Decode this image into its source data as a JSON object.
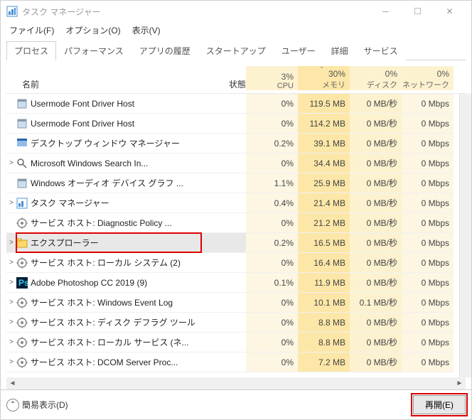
{
  "window": {
    "title": "タスク マネージャー"
  },
  "menus": [
    "ファイル(F)",
    "オプション(O)",
    "表示(V)"
  ],
  "tabs": [
    "プロセス",
    "パフォーマンス",
    "アプリの履歴",
    "スタートアップ",
    "ユーザー",
    "詳細",
    "サービス"
  ],
  "headers": {
    "name": "名前",
    "status": "状態",
    "cols": [
      {
        "pct": "3%",
        "lbl": "CPU",
        "sort": false
      },
      {
        "pct": "30%",
        "lbl": "メモリ",
        "sort": true
      },
      {
        "pct": "0%",
        "lbl": "ディスク",
        "sort": false
      },
      {
        "pct": "0%",
        "lbl": "ネットワーク",
        "sort": false
      }
    ]
  },
  "rows": [
    {
      "exp": "",
      "icon": "app",
      "name": "Usermode Font Driver Host",
      "cpu": "0%",
      "mem": "119.5 MB",
      "disk": "0 MB/秒",
      "net": "0 Mbps"
    },
    {
      "exp": "",
      "icon": "app",
      "name": "Usermode Font Driver Host",
      "cpu": "0%",
      "mem": "114.2 MB",
      "disk": "0 MB/秒",
      "net": "0 Mbps"
    },
    {
      "exp": "",
      "icon": "dwm",
      "name": "デスクトップ ウィンドウ マネージャー",
      "cpu": "0.2%",
      "mem": "39.1 MB",
      "disk": "0 MB/秒",
      "net": "0 Mbps"
    },
    {
      "exp": ">",
      "icon": "search",
      "name": "Microsoft Windows Search In...",
      "cpu": "0%",
      "mem": "34.4 MB",
      "disk": "0 MB/秒",
      "net": "0 Mbps"
    },
    {
      "exp": "",
      "icon": "app",
      "name": "Windows オーディオ デバイス グラフ ...",
      "cpu": "1.1%",
      "mem": "25.9 MB",
      "disk": "0 MB/秒",
      "net": "0 Mbps"
    },
    {
      "exp": ">",
      "icon": "tm",
      "name": "タスク マネージャー",
      "cpu": "0.4%",
      "mem": "21.4 MB",
      "disk": "0 MB/秒",
      "net": "0 Mbps"
    },
    {
      "exp": "",
      "icon": "svc",
      "name": "サービス ホスト: Diagnostic Policy ...",
      "cpu": "0%",
      "mem": "21.2 MB",
      "disk": "0 MB/秒",
      "net": "0 Mbps"
    },
    {
      "exp": ">",
      "icon": "exp",
      "name": "エクスプローラー",
      "cpu": "0.2%",
      "mem": "16.5 MB",
      "disk": "0 MB/秒",
      "net": "0 Mbps",
      "sel": true,
      "hl": true
    },
    {
      "exp": ">",
      "icon": "svc",
      "name": "サービス ホスト: ローカル システム (2)",
      "cpu": "0%",
      "mem": "16.4 MB",
      "disk": "0 MB/秒",
      "net": "0 Mbps"
    },
    {
      "exp": ">",
      "icon": "ps",
      "name": "Adobe Photoshop CC 2019 (9)",
      "cpu": "0.1%",
      "mem": "11.9 MB",
      "disk": "0 MB/秒",
      "net": "0 Mbps"
    },
    {
      "exp": ">",
      "icon": "svc",
      "name": "サービス ホスト: Windows Event Log",
      "cpu": "0%",
      "mem": "10.1 MB",
      "disk": "0.1 MB/秒",
      "net": "0 Mbps"
    },
    {
      "exp": ">",
      "icon": "svc",
      "name": "サービス ホスト: ディスク デフラグ ツール",
      "cpu": "0%",
      "mem": "8.8 MB",
      "disk": "0 MB/秒",
      "net": "0 Mbps"
    },
    {
      "exp": ">",
      "icon": "svc",
      "name": "サービス ホスト: ローカル サービス (ネ...",
      "cpu": "0%",
      "mem": "8.8 MB",
      "disk": "0 MB/秒",
      "net": "0 Mbps"
    },
    {
      "exp": ">",
      "icon": "svc",
      "name": "サービス ホスト: DCOM Server Proc...",
      "cpu": "0%",
      "mem": "7.2 MB",
      "disk": "0 MB/秒",
      "net": "0 Mbps"
    }
  ],
  "footer": {
    "fewer": "簡易表示(D)",
    "restart": "再開(E)"
  }
}
